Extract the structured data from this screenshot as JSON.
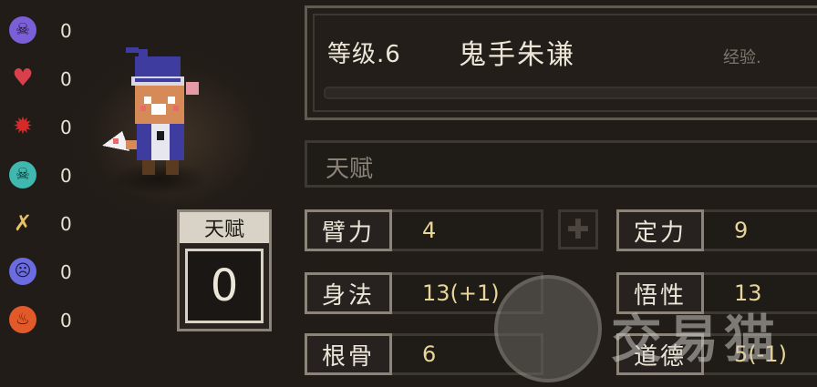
{
  "status_effects": [
    {
      "icon": "purple-skull-icon",
      "color": "#7a5fd6",
      "count": "0"
    },
    {
      "icon": "broken-heart-icon",
      "color": "#d8404c",
      "count": "0"
    },
    {
      "icon": "red-splat-icon",
      "color": "#d42a2a",
      "count": "0"
    },
    {
      "icon": "teal-poison-skull-icon",
      "color": "#3fb8b0",
      "count": "0"
    },
    {
      "icon": "broken-bone-icon",
      "color": "#e8c064",
      "count": "0"
    },
    {
      "icon": "purple-ghost-face-icon",
      "color": "#6a6ce0",
      "count": "0"
    },
    {
      "icon": "fire-icon",
      "color": "#e25a2a",
      "count": "0"
    }
  ],
  "talent_box": {
    "label": "天赋",
    "value": "0"
  },
  "character": {
    "level_text": "等级.6",
    "name": "鬼手朱谦",
    "exp_label": "经验."
  },
  "talent_field": {
    "label": "天赋"
  },
  "stats": {
    "bili": {
      "label": "臂力",
      "value": "4"
    },
    "dingli": {
      "label": "定力",
      "value": "9"
    },
    "shenfa": {
      "label": "身法",
      "value": "13(+1)"
    },
    "wuxing": {
      "label": "悟性",
      "value": "13"
    },
    "gengu": {
      "label": "根骨",
      "value": "6"
    },
    "daode": {
      "label": "道德",
      "value": "5(-1)"
    }
  },
  "watermark": {
    "text": "交易猫"
  }
}
